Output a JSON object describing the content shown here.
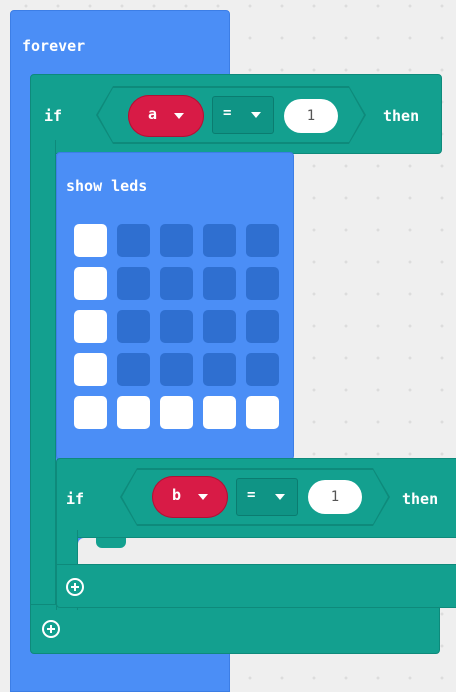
{
  "forever_block": {
    "label": "forever"
  },
  "outer_if": {
    "if_label": "if",
    "variable": "a",
    "operator": "=",
    "value": "1",
    "then_label": "then"
  },
  "show_leds": {
    "label": "show leds",
    "grid": [
      [
        1,
        0,
        0,
        0,
        0
      ],
      [
        1,
        0,
        0,
        0,
        0
      ],
      [
        1,
        0,
        0,
        0,
        0
      ],
      [
        1,
        0,
        0,
        0,
        0
      ],
      [
        1,
        1,
        1,
        1,
        1
      ]
    ]
  },
  "inner_if": {
    "if_label": "if",
    "variable": "b",
    "operator": "=",
    "value": "1",
    "then_label": "then"
  },
  "colors": {
    "loops_blue": "#4b8ef6",
    "logic_teal": "#13a08f",
    "variable_red": "#d81b46",
    "led_off": "#2f6fd0",
    "led_on": "#ffffff"
  },
  "icons": {
    "add_else_outer": "plus-circle-icon",
    "add_else_inner": "plus-circle-icon",
    "dropdown": "caret-down-icon"
  }
}
